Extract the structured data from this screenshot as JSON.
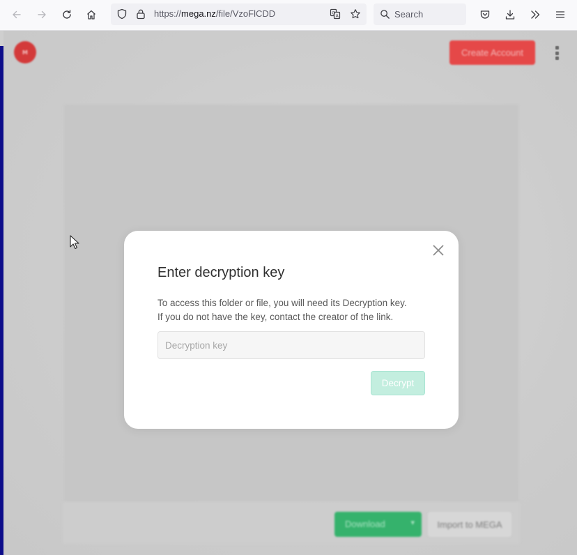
{
  "browser": {
    "url_prefix": "https://",
    "url_domain": "mega.nz",
    "url_path": "/file/VzoFlCDD",
    "search_placeholder": "Search"
  },
  "page": {
    "logo_text": "M",
    "create_account_label": "Create Account",
    "download_label": "Download",
    "import_label": "Import to MEGA"
  },
  "dialog": {
    "title": "Enter decryption key",
    "description_line1": "To access this folder or file, you will need its Decryption key.",
    "description_line2": "If you do not have the key, contact the creator of the link.",
    "input_placeholder": "Decryption key",
    "input_value": "",
    "decrypt_label": "Decrypt"
  },
  "colors": {
    "mega_red": "#d9272e",
    "decrypt_disabled": "#c3eedf",
    "download_green": "#35b26c"
  },
  "icons": [
    "back-icon",
    "forward-icon",
    "reload-icon",
    "home-icon",
    "shield-icon",
    "lock-icon",
    "translate-icon",
    "bookmark-star-icon",
    "search-icon",
    "pocket-icon",
    "download-icon",
    "overflow-icon",
    "menu-icon",
    "close-icon",
    "kebab-menu-icon",
    "chevron-down-icon",
    "mouse-cursor-icon"
  ]
}
